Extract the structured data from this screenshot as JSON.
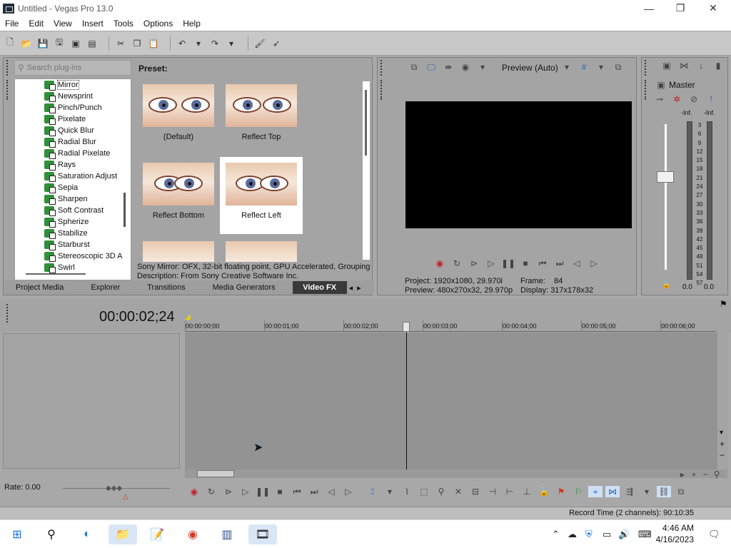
{
  "window": {
    "title": "Untitled - Vegas Pro 13.0",
    "minimize": "—",
    "maximize": "❐",
    "close": "✕"
  },
  "menu": [
    "File",
    "Edit",
    "View",
    "Insert",
    "Tools",
    "Options",
    "Help"
  ],
  "plugins": {
    "search_placeholder": "Search plug-ins",
    "items": [
      "Mirror",
      "Newsprint",
      "Pinch/Punch",
      "Pixelate",
      "Quick Blur",
      "Radial Blur",
      "Radial Pixelate",
      "Rays",
      "Saturation Adjust",
      "Sepia",
      "Sharpen",
      "Soft Contrast",
      "Spherize",
      "Stabilize",
      "Starburst",
      "Stereoscopic 3D A",
      "Swirl"
    ],
    "selected": "Mirror"
  },
  "presets": {
    "label": "Preset:",
    "items": [
      "(Default)",
      "Reflect Top",
      "Reflect Bottom",
      "Reflect Left"
    ],
    "selected": "Reflect Left"
  },
  "description": {
    "line1": "Sony Mirror: OFX, 32-bit floating point, GPU Accelerated, Grouping S",
    "line2": "Description: From Sony Creative Software Inc."
  },
  "tabs": [
    "Project Media",
    "Explorer",
    "Transitions",
    "Media Generators",
    "Video FX"
  ],
  "active_tab": "Video FX",
  "preview": {
    "mode": "Preview (Auto)",
    "project_label": "Project:",
    "project_value": "1920x1080, 29.970i",
    "preview_label": "Preview:",
    "preview_value": "480x270x32, 29.970p",
    "frame_label": "Frame:",
    "frame_value": "84",
    "display_label": "Display:",
    "display_value": "317x178x32"
  },
  "master": {
    "label": "Master",
    "inf_left": "-Inf.",
    "inf_right": "-Inf.",
    "scale": [
      "3",
      "6",
      "9",
      "12",
      "15",
      "18",
      "21",
      "24",
      "27",
      "30",
      "33",
      "36",
      "39",
      "42",
      "45",
      "48",
      "51",
      "54",
      "57"
    ],
    "level_left": "0.0",
    "level_right": "0.0"
  },
  "timeline": {
    "timecode": "00:00:02;24",
    "ruler": [
      "00:00:00;00",
      "00:00:01;00",
      "00:00:02;00",
      "00:00:03;00",
      "00:00:04;00",
      "00:00:05;00",
      "00:00:06;00"
    ]
  },
  "rate": "Rate: 0.00",
  "status": {
    "record_time": "Record Time (2 channels): 90:10:35"
  },
  "taskbar": {
    "time": "4:46 AM",
    "date": "4/16/2023"
  }
}
